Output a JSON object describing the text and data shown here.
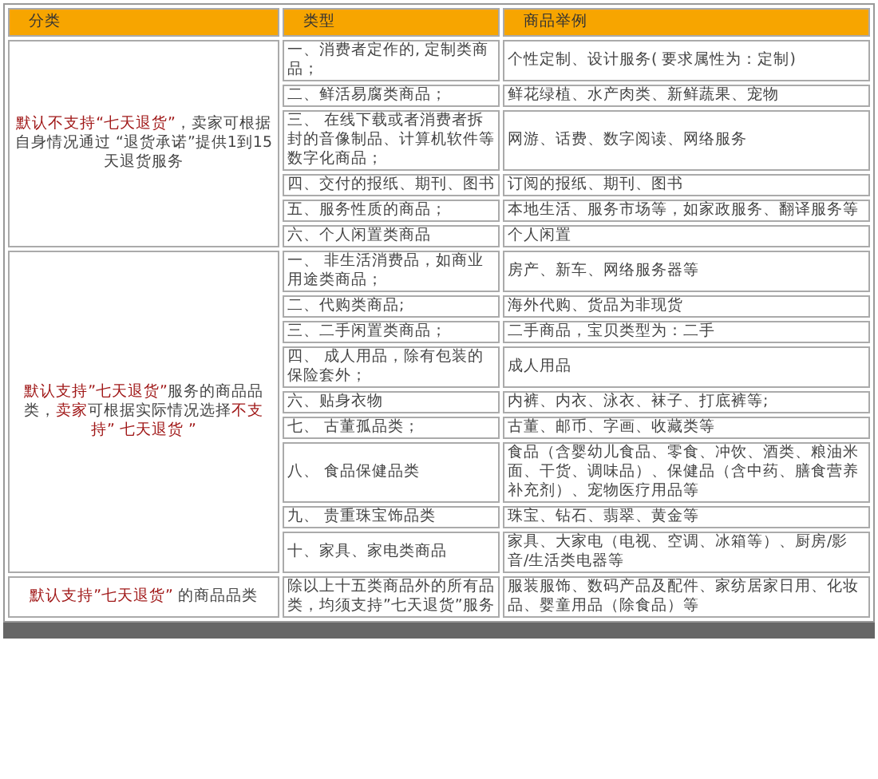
{
  "table": {
    "columns": [
      "分类",
      "类型",
      "商品举例"
    ],
    "groups": [
      {
        "category": [
          {
            "text": "默认不支持“七天退货”",
            "highlight": true
          },
          {
            "text": "，卖家可根据自身情况通过 “退货承诺”提供1到15天退货服务",
            "highlight": false
          }
        ],
        "rows": [
          {
            "type": "一、消费者定作的, 定制类商品；",
            "example": "个性定制、设计服务( 要求属性为：定制)"
          },
          {
            "type": "二、鲜活易腐类商品；",
            "example": "鲜花绿植、水产肉类、新鲜蔬果、宠物"
          },
          {
            "type": "三、 在线下载或者消费者拆封的音像制品、计算机软件等数字化商品；",
            "example": "网游、话费、数字阅读、网络服务"
          },
          {
            "type": "四、交付的报纸、期刊、图书",
            "example": "订阅的报纸、期刊、图书"
          },
          {
            "type": "五、服务性质的商品；",
            "example": "本地生活、服务市场等，如家政服务、翻译服务等"
          },
          {
            "type": "六、个人闲置类商品",
            "example": "个人闲置"
          }
        ]
      },
      {
        "category": [
          {
            "text": "默认支持”七天退货”",
            "highlight": true
          },
          {
            "text": "服务的商品品类，",
            "highlight": false
          },
          {
            "text": "卖家",
            "highlight": true
          },
          {
            "text": "可根据实际情况选择",
            "highlight": false
          },
          {
            "text": "不支持” 七天退货 ”",
            "highlight": true
          }
        ],
        "rows": [
          {
            "type": "一、 非生活消费品，如商业用途类商品；",
            "example": "房产、新车、网络服务器等"
          },
          {
            "type": "二、代购类商品;",
            "example": "海外代购、货品为非现货"
          },
          {
            "type": "三、二手闲置类商品；",
            "example": "二手商品，宝贝类型为：二手"
          },
          {
            "type": "四、 成人用品，除有包装的保险套外；",
            "example": "成人用品"
          },
          {
            "type": "六、贴身衣物",
            "example": "内裤、内衣、泳衣、袜子、打底裤等;"
          },
          {
            "type": "七、 古董孤品类；",
            "example": "古董、邮币、字画、收藏类等"
          },
          {
            "type": "八、 食品保健品类",
            "example": "食品（含婴幼儿食品、零食、冲饮、酒类、粮油米面、干货、调味品）、保健品（含中药、膳食营养补充剂）、宠物医疗用品等"
          },
          {
            "type": "九、 贵重珠宝饰品类",
            "example": "珠宝、钻石、翡翠、黄金等"
          },
          {
            "type": "十、家具、家电类商品",
            "example": "家具、大家电（电视、空调、冰箱等）、厨房/影音/生活类电器等"
          }
        ]
      },
      {
        "category": [
          {
            "text": "默认支持”七天退货”",
            "highlight": true
          },
          {
            "text": " 的商品品类",
            "highlight": false
          }
        ],
        "rows": [
          {
            "type": "除以上十五类商品外的所有品类，均须支持”七天退货”服务",
            "example": "服装服饰、数码产品及配件、家纺居家日用、化妆品、婴童用品（除食品）等"
          }
        ]
      }
    ]
  }
}
